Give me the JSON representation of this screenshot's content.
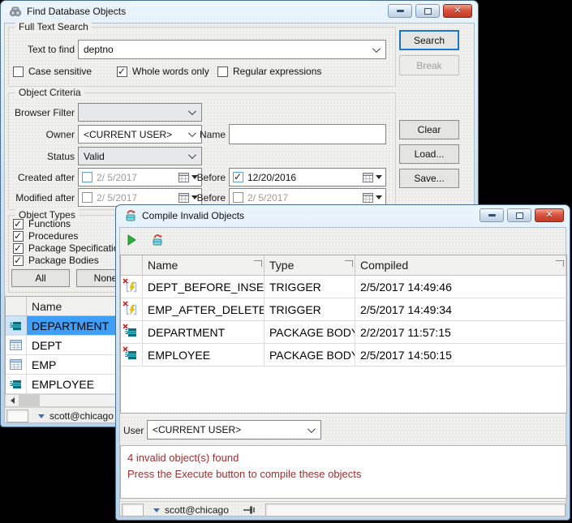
{
  "colors": {
    "selection": "#3f9ef8",
    "message_text": "#9c2f2f",
    "titlebar_gradient_top": "#eaf4fc",
    "close_button_red": "#c03a24",
    "focus_border_blue": "#1777cd"
  },
  "find_window": {
    "title": "Find Database Objects",
    "full_text_search": {
      "legend": "Full Text Search",
      "text_to_find_label": "Text to find",
      "text_to_find_value": "deptno",
      "case_sensitive": {
        "label": "Case sensitive",
        "checked": false
      },
      "whole_words": {
        "label": "Whole words only",
        "checked": true
      },
      "regex": {
        "label": "Regular expressions",
        "checked": false
      }
    },
    "search_button": "Search",
    "break_button": "Break",
    "clear_button": "Clear",
    "load_button": "Load...",
    "save_button": "Save...",
    "object_criteria": {
      "legend": "Object Criteria",
      "browser_filter_label": "Browser Filter",
      "browser_filter_value": "",
      "owner_label": "Owner",
      "owner_value": "<CURRENT USER>",
      "name_label": "Name",
      "name_value": "",
      "status_label": "Status",
      "status_value": "Valid",
      "created_after_label": "Created after",
      "created_after": {
        "checked": false,
        "value": "2/ 5/2017"
      },
      "created_before_label": "Before",
      "created_before": {
        "checked": true,
        "value": "12/20/2016"
      },
      "modified_after_label": "Modified after",
      "modified_after": {
        "checked": false,
        "value": "2/ 5/2017"
      },
      "modified_before_label": "Before",
      "modified_before": {
        "checked": false,
        "value": "2/ 5/2017"
      }
    },
    "object_types": {
      "legend": "Object Types",
      "items": [
        {
          "label": "Functions",
          "checked": true
        },
        {
          "label": "Procedures",
          "checked": true
        },
        {
          "label": "Package Specifications",
          "checked": true
        },
        {
          "label": "Package Bodies",
          "checked": true
        }
      ],
      "all_button": "All",
      "none_button": "None"
    },
    "results_grid": {
      "name_header": "Name",
      "rows": [
        {
          "icon": "package-icon",
          "name": "DEPARTMENT",
          "selected": true
        },
        {
          "icon": "table-icon",
          "name": "DEPT",
          "selected": false
        },
        {
          "icon": "table-icon",
          "name": "EMP",
          "selected": false
        },
        {
          "icon": "package-icon",
          "name": "EMPLOYEE",
          "selected": false
        }
      ]
    },
    "status_bar": {
      "connection": "scott@chicago"
    }
  },
  "compile_window": {
    "title": "Compile Invalid Objects",
    "toolbar": {
      "execute_icon": "execute-play-icon",
      "refresh_icon": "compile-refresh-icon"
    },
    "grid": {
      "headers": {
        "name": "Name",
        "type": "Type",
        "compiled": "Compiled"
      },
      "rows": [
        {
          "icon": "trigger-invalid-icon",
          "name": "DEPT_BEFORE_INSERT",
          "type": "TRIGGER",
          "compiled": "2/5/2017 14:49:46"
        },
        {
          "icon": "trigger-invalid-icon",
          "name": "EMP_AFTER_DELETE",
          "type": "TRIGGER",
          "compiled": "2/5/2017 14:49:34"
        },
        {
          "icon": "package-invalid-icon",
          "name": "DEPARTMENT",
          "type": "PACKAGE BODY",
          "compiled": "2/2/2017 11:57:15"
        },
        {
          "icon": "package-invalid-icon",
          "name": "EMPLOYEE",
          "type": "PACKAGE BODY",
          "compiled": "2/5/2017 14:50:15"
        }
      ]
    },
    "user_label": "User",
    "user_value": "<CURRENT USER>",
    "message_line1": "4 invalid object(s) found",
    "message_line2": "Press the Execute button to compile these objects",
    "status_bar": {
      "connection": "scott@chicago"
    }
  }
}
